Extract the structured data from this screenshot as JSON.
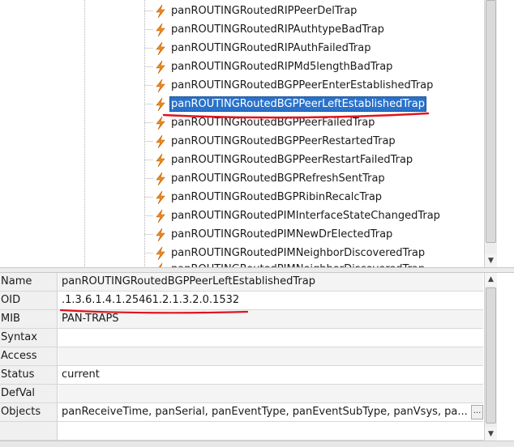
{
  "tree": {
    "items": [
      {
        "label": "panROUTINGRoutedRIPPeerDelTrap"
      },
      {
        "label": "panROUTINGRoutedRIPAuthtypeBadTrap"
      },
      {
        "label": "panROUTINGRoutedRIPAuthFailedTrap"
      },
      {
        "label": "panROUTINGRoutedRIPMd5lengthBadTrap"
      },
      {
        "label": "panROUTINGRoutedBGPPeerEnterEstablishedTrap"
      },
      {
        "label": "panROUTINGRoutedBGPPeerLeftEstablishedTrap",
        "selected": true
      },
      {
        "label": "panROUTINGRoutedBGPPeerFailedTrap"
      },
      {
        "label": "panROUTINGRoutedBGPPeerRestartedTrap"
      },
      {
        "label": "panROUTINGRoutedBGPPeerRestartFailedTrap"
      },
      {
        "label": "panROUTINGRoutedBGPRefreshSentTrap"
      },
      {
        "label": "panROUTINGRoutedBGPRibinRecalcTrap"
      },
      {
        "label": "panROUTINGRoutedPIMInterfaceStateChangedTrap"
      },
      {
        "label": "panROUTINGRoutedPIMNewDrElectedTrap"
      },
      {
        "label": "panROUTINGRoutedPIMNeighborDiscoveredTrap"
      }
    ],
    "clipped_item": "panROUTINGRoutedPIMNeighborDiscoveredTrap",
    "icon": "trap-lightning-icon"
  },
  "properties": {
    "rows": [
      {
        "key": "Name",
        "value": "panROUTINGRoutedBGPPeerLeftEstablishedTrap"
      },
      {
        "key": "OID",
        "value": ".1.3.6.1.4.1.25461.2.1.3.2.0.1532"
      },
      {
        "key": "MIB",
        "value": "PAN-TRAPS"
      },
      {
        "key": "Syntax",
        "value": ""
      },
      {
        "key": "Access",
        "value": ""
      },
      {
        "key": "Status",
        "value": "current"
      },
      {
        "key": "DefVal",
        "value": ""
      },
      {
        "key": "Objects",
        "value": "panReceiveTime, panSerial, panEventType, panEventSubType, panVsys, pa..."
      }
    ],
    "ellipsis_button": "..."
  },
  "colors": {
    "selection": "#2a72c9",
    "annotation_red": "#e0141e",
    "icon_orange": "#f08a1c"
  }
}
